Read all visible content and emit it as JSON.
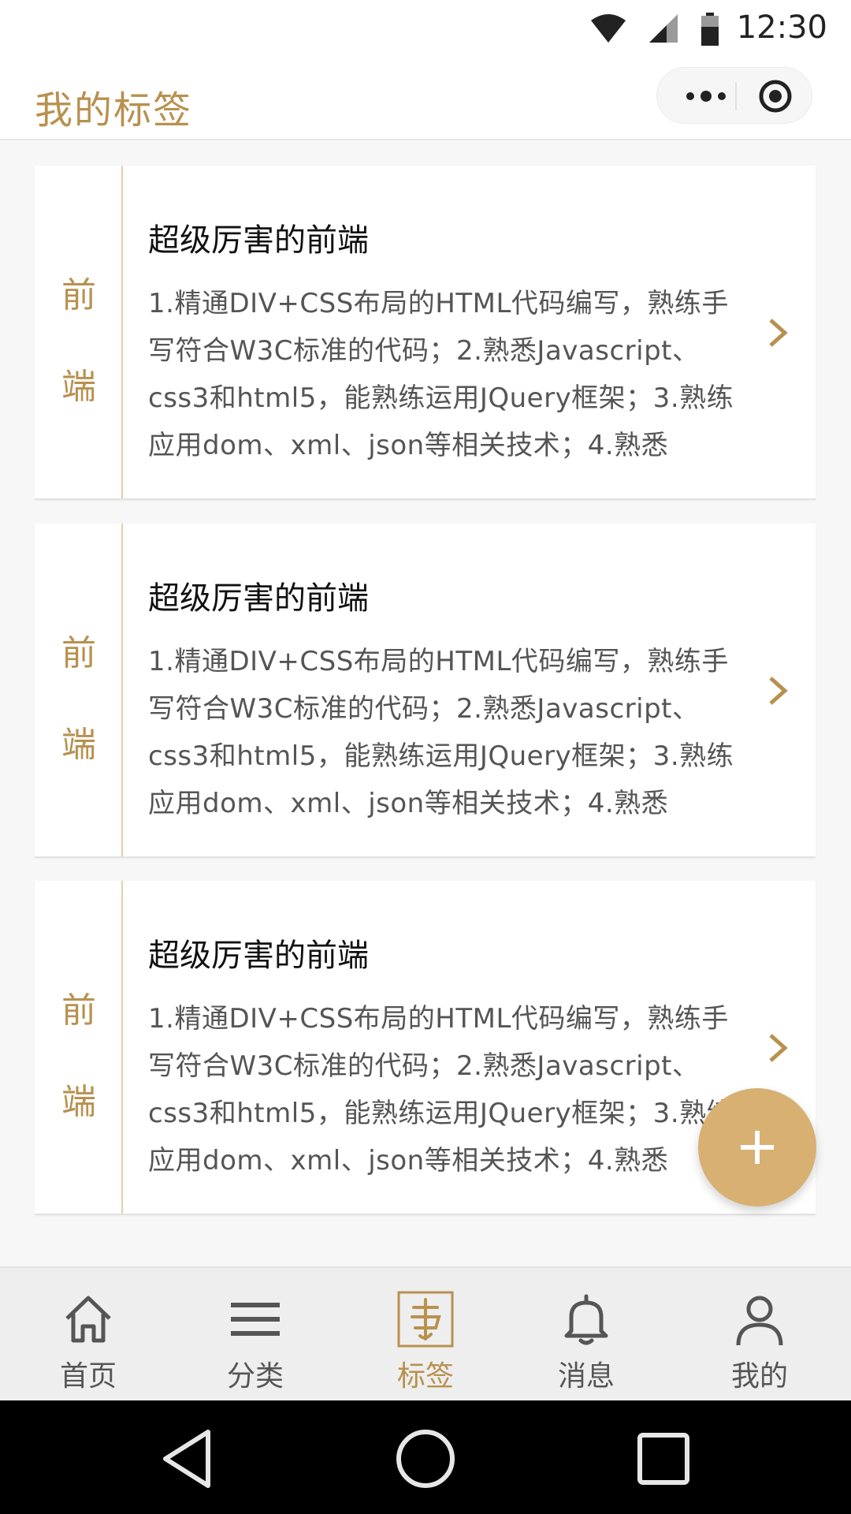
{
  "status": {
    "time": "12:30"
  },
  "header": {
    "title": "我的标签",
    "capsule_more_icon": "more-dots-icon",
    "capsule_close_icon": "target-close-icon"
  },
  "cards": [
    {
      "tag_chars": [
        "前",
        "端"
      ],
      "title": "超级厉害的前端",
      "description": "1.精通DIV+CSS布局的HTML代码编写，熟练手写符合W3C标准的代码；2.熟悉Javascript、css3和html5，能熟练运用JQuery框架；3.熟练应用dom、xml、json等相关技术；4.熟悉"
    },
    {
      "tag_chars": [
        "前",
        "端"
      ],
      "title": "超级厉害的前端",
      "description": "1.精通DIV+CSS布局的HTML代码编写，熟练手写符合W3C标准的代码；2.熟悉Javascript、css3和html5，能熟练运用JQuery框架；3.熟练应用dom、xml、json等相关技术；4.熟悉"
    },
    {
      "tag_chars": [
        "前",
        "端"
      ],
      "title": "超级厉害的前端",
      "description": "1.精通DIV+CSS布局的HTML代码编写，熟练手写符合W3C标准的代码；2.熟悉Javascript、css3和html5，能熟练运用JQuery框架；3.熟练应用dom、xml、json等相关技术；4.熟悉"
    }
  ],
  "fab": {
    "icon": "plus-icon"
  },
  "tabbar": {
    "items": [
      {
        "label": "首页",
        "icon": "home-icon",
        "active": false
      },
      {
        "label": "分类",
        "icon": "menu-icon",
        "active": false
      },
      {
        "label": "标签",
        "icon": "tag-seal-icon",
        "active": true
      },
      {
        "label": "消息",
        "icon": "bell-icon",
        "active": false
      },
      {
        "label": "我的",
        "icon": "user-icon",
        "active": false
      }
    ]
  },
  "colors": {
    "accent": "#b8914f",
    "fab": "#d7b072",
    "tag_border": "#e8cfaa"
  }
}
